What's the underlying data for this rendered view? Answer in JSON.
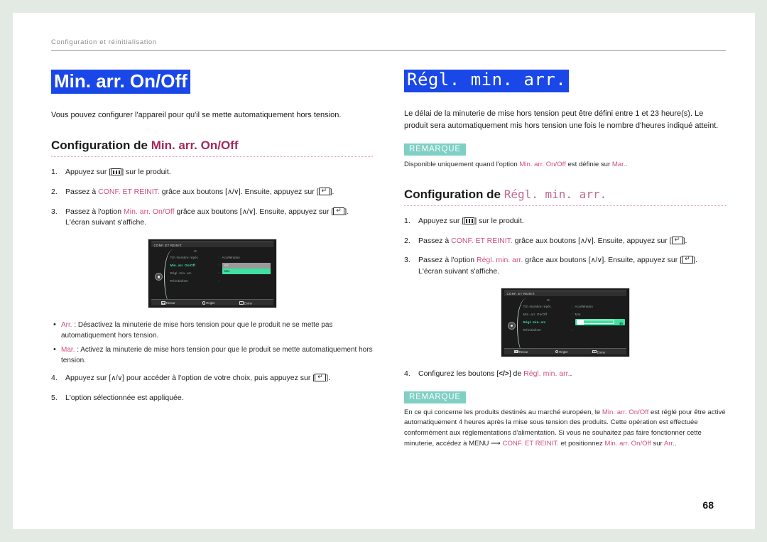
{
  "running_header": "Configuration et réinitialisation",
  "page_number": "68",
  "colors": {
    "title_highlight_bg": "#1a47e8",
    "accent_pink": "#a6265c",
    "link_pink": "#d0507f",
    "note_badge_bg": "#7fcfc4",
    "osd_green": "#3fe0a0",
    "page_bg": "#e3eae3"
  },
  "left": {
    "title": "Min. arr. On/Off",
    "intro": "Vous pouvez configurer l'appareil pour qu'il se mette automatiquement hors tension.",
    "section_heading_prefix": "Configuration de ",
    "section_heading_term": "Min. arr. On/Off",
    "steps": [
      {
        "num": "1.",
        "parts": [
          {
            "t": "text",
            "v": "Appuyez sur ["
          },
          {
            "t": "key",
            "v": "menu-key"
          },
          {
            "t": "text",
            "v": "] sur le produit."
          }
        ]
      },
      {
        "num": "2.",
        "parts": [
          {
            "t": "text",
            "v": "Passez à "
          },
          {
            "t": "pink",
            "v": "CONF. ET REINIT."
          },
          {
            "t": "text",
            "v": " grâce aux boutons ["
          },
          {
            "t": "arrows",
            "v": "∧/∨"
          },
          {
            "t": "text",
            "v": "]. Ensuite, appuyez sur ["
          },
          {
            "t": "key",
            "v": "enter-key"
          },
          {
            "t": "text",
            "v": "]."
          }
        ]
      },
      {
        "num": "3.",
        "parts": [
          {
            "t": "text",
            "v": "Passez à l'option "
          },
          {
            "t": "pink",
            "v": "Min. arr. On/Off"
          },
          {
            "t": "text",
            "v": " grâce aux boutons ["
          },
          {
            "t": "arrows",
            "v": "∧/∨"
          },
          {
            "t": "text",
            "v": "]. Ensuite, appuyez sur ["
          },
          {
            "t": "key",
            "v": "enter-key"
          },
          {
            "t": "text",
            "v": "]."
          },
          {
            "t": "break",
            "v": ""
          },
          {
            "t": "text",
            "v": "L'écran suivant s'affiche."
          }
        ]
      }
    ],
    "osd": {
      "title": "CONF. ET REINIT.",
      "rows": [
        "Tch Nombre répét.",
        "Min. arr. On/Off",
        "Régl. min. arr.",
        "Réinitialiser"
      ],
      "active_row_index": 1,
      "values": [
        "Accélération",
        "",
        "",
        ""
      ],
      "options": [
        {
          "label": "Arr.",
          "state": "off"
        },
        {
          "label": "Mar.",
          "state": "on"
        }
      ],
      "footer": [
        {
          "icon": "menu-icon",
          "label": "Retour"
        },
        {
          "icon": "circle-icon",
          "label": "Régler"
        },
        {
          "icon": "enter-icon",
          "label": "Entrer"
        }
      ]
    },
    "bullets": [
      {
        "term": "Arr.",
        "text": " : Désactivez la minuterie de mise hors tension pour que le produit ne se mette pas automatiquement hors tension."
      },
      {
        "term": "Mar.",
        "text": " : Activez la minuterie de mise hors tension pour que le produit se mette automatiquement hors tension."
      }
    ],
    "steps_after": [
      {
        "num": "4.",
        "parts": [
          {
            "t": "text",
            "v": "Appuyez sur ["
          },
          {
            "t": "arrows",
            "v": "∧/∨"
          },
          {
            "t": "text",
            "v": "] pour accéder à l'option de votre choix, puis appuyez sur ["
          },
          {
            "t": "key",
            "v": "enter-key"
          },
          {
            "t": "text",
            "v": "]."
          }
        ]
      },
      {
        "num": "5.",
        "parts": [
          {
            "t": "text",
            "v": "L'option sélectionnée est appliquée."
          }
        ]
      }
    ]
  },
  "right": {
    "title": "Régl. min. arr.",
    "intro": "Le délai de la minuterie de mise hors tension peut être défini entre 1 et 23 heure(s). Le produit sera automatiquement mis hors tension une fois le nombre d'heures indiqué atteint.",
    "note_top": {
      "badge": "REMARQUE",
      "parts": [
        {
          "t": "text",
          "v": "Disponible uniquement quand l'option "
        },
        {
          "t": "pink",
          "v": "Min. arr. On/Off"
        },
        {
          "t": "text",
          "v": " est définie sur "
        },
        {
          "t": "pink",
          "v": "Mar."
        },
        {
          "t": "text",
          "v": "."
        }
      ]
    },
    "section_heading_prefix": "Configuration de ",
    "section_heading_term": "Régl. min. arr.",
    "steps": [
      {
        "num": "1.",
        "parts": [
          {
            "t": "text",
            "v": "Appuyez sur ["
          },
          {
            "t": "key",
            "v": "menu-key"
          },
          {
            "t": "text",
            "v": "] sur le produit."
          }
        ]
      },
      {
        "num": "2.",
        "parts": [
          {
            "t": "text",
            "v": "Passez à "
          },
          {
            "t": "pink",
            "v": "CONF. ET REINIT."
          },
          {
            "t": "text",
            "v": " grâce aux boutons ["
          },
          {
            "t": "arrows",
            "v": "∧/∨"
          },
          {
            "t": "text",
            "v": "]. Ensuite, appuyez sur ["
          },
          {
            "t": "key",
            "v": "enter-key"
          },
          {
            "t": "text",
            "v": "]."
          }
        ]
      },
      {
        "num": "3.",
        "parts": [
          {
            "t": "text",
            "v": "Passez à l'option "
          },
          {
            "t": "pink",
            "v": "Régl. min. arr."
          },
          {
            "t": "text",
            "v": " grâce aux boutons ["
          },
          {
            "t": "arrows",
            "v": "∧/∨"
          },
          {
            "t": "text",
            "v": "]. Ensuite, appuyez sur ["
          },
          {
            "t": "key",
            "v": "enter-key"
          },
          {
            "t": "text",
            "v": "]."
          },
          {
            "t": "break",
            "v": ""
          },
          {
            "t": "text",
            "v": "L'écran suivant s'affiche."
          }
        ]
      }
    ],
    "osd": {
      "title": "CONF. ET REINIT.",
      "rows": [
        "Tch Nombre répét.",
        "Min. arr. On/Off",
        "Régl. min. arr.",
        "Réinitialiser"
      ],
      "active_row_index": 2,
      "values": [
        "Accélération",
        "Mar.",
        "",
        ""
      ],
      "slider": {
        "value_label": "4h",
        "fill_percent": 18
      },
      "footer": [
        {
          "icon": "menu-icon",
          "label": "Retour"
        },
        {
          "icon": "circle-icon",
          "label": "Régler"
        },
        {
          "icon": "enter-icon",
          "label": "Entrer"
        }
      ]
    },
    "steps_after": [
      {
        "num": "4.",
        "parts": [
          {
            "t": "text",
            "v": "Configurez les boutons ["
          },
          {
            "t": "lr",
            "v": "</>"
          },
          {
            "t": "text",
            "v": "] de "
          },
          {
            "t": "pink",
            "v": "Régl. min. arr."
          },
          {
            "t": "text",
            "v": "."
          }
        ]
      }
    ],
    "note_bottom": {
      "badge": "REMARQUE",
      "parts": [
        {
          "t": "text",
          "v": "En ce qui concerne les produits destinés au marché européen, le "
        },
        {
          "t": "pink",
          "v": "Min. arr. On/Off"
        },
        {
          "t": "text",
          "v": " est réglé pour être activé automatiquement 4 heures après la mise sous tension des produits. Cette opération est effectuée conformément aux réglementations d'alimentation. Si vous ne souhaitez pas faire fonctionner cette minuterie, accédez à MENU ⟶ "
        },
        {
          "t": "pink",
          "v": "CONF. ET REINIT."
        },
        {
          "t": "text",
          "v": " et positionnez "
        },
        {
          "t": "pink",
          "v": "Min. arr. On/Off"
        },
        {
          "t": "text",
          "v": " sur "
        },
        {
          "t": "pink",
          "v": "Arr."
        },
        {
          "t": "text",
          "v": "."
        }
      ]
    }
  }
}
